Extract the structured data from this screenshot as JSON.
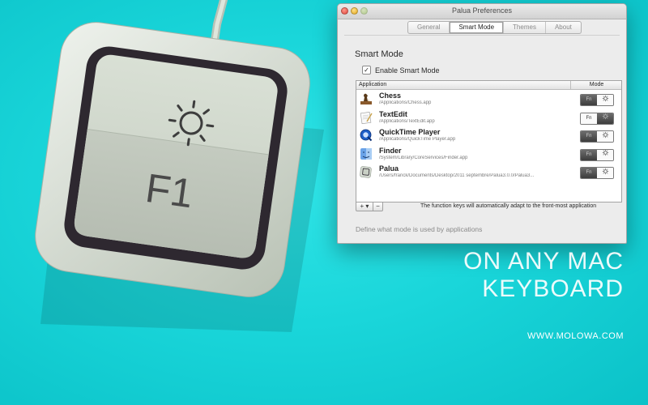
{
  "key": {
    "label": "F1"
  },
  "window": {
    "title": "Palua Preferences",
    "tabs": [
      {
        "label": "General",
        "active": false
      },
      {
        "label": "Smart Mode",
        "active": true
      },
      {
        "label": "Themes",
        "active": false
      },
      {
        "label": "About",
        "active": false
      }
    ],
    "section_title": "Smart Mode",
    "enable_checkbox": {
      "label": "Enable Smart Mode",
      "checked": true,
      "mark": "✓"
    },
    "table": {
      "columns": [
        "Application",
        "Mode"
      ],
      "rows": [
        {
          "name": "Chess",
          "path": "/Applications/Chess.app",
          "icon": "chess-icon",
          "mode": "brightness"
        },
        {
          "name": "TextEdit",
          "path": "/Applications/TextEdit.app",
          "icon": "textedit-icon",
          "mode": "fn"
        },
        {
          "name": "QuickTime Player",
          "path": "/Applications/QuickTime Player.app",
          "icon": "quicktime-icon",
          "mode": "brightness"
        },
        {
          "name": "Finder",
          "path": "/System/Library/CoreServices/Finder.app",
          "icon": "finder-icon",
          "mode": "brightness"
        },
        {
          "name": "Palua",
          "path": "/Users/franck/Documents/Desktop/2011 septembre/Palua3.0.0/Palua3...",
          "icon": "palua-icon",
          "mode": "brightness"
        }
      ],
      "toggle_fn_label": "Fn"
    },
    "add_button": "+ ▾",
    "remove_button": "−",
    "info_text": "The function keys will automatically adapt to the front-most application",
    "footer_text": "Define what mode is used by applications"
  },
  "promo": {
    "line1": "ON ANY MAC",
    "line2": "KEYBOARD",
    "website": "WWW.MOLOWA.COM"
  },
  "colors": {
    "background": "#1ad6da",
    "key_body": "#dfe6dc",
    "key_ring": "#2e2830"
  }
}
